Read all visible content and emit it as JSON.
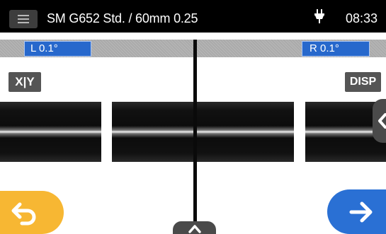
{
  "status_bar": {
    "menu_icon": "hamburger-menu-icon",
    "title": "SM G652 Std. / 60mm 0.25",
    "power_icon": "ac-plug-icon",
    "time": "08:33"
  },
  "angles": {
    "left_label": "L  0.1°",
    "right_label": "R  0.1°"
  },
  "buttons": {
    "xy_label": "X|Y",
    "disp_label": "DISP",
    "back_icon": "back-arrow-icon",
    "next_icon": "right-arrow-icon",
    "side_handle_icon": "chevron-left-icon",
    "bottom_handle_icon": "chevron-up-icon"
  },
  "colors": {
    "status_bar": "#000000",
    "angle_box": "#2768cc",
    "back_button": "#f7b733",
    "next_button": "#2a70d4",
    "handle": "#4a4a4a"
  }
}
